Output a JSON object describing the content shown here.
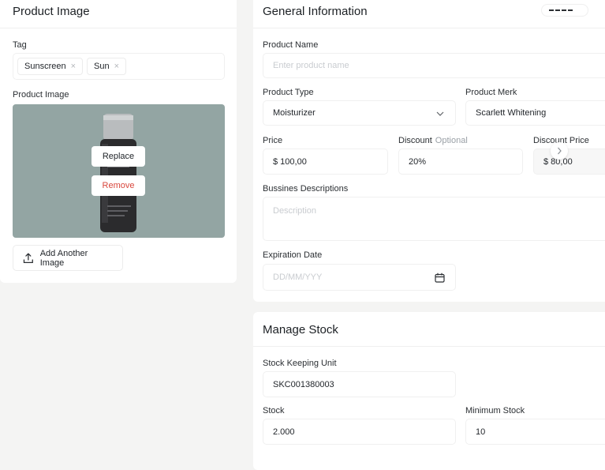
{
  "product_image_card": {
    "title": "Product Image",
    "tag_label": "Tag",
    "tags": [
      "Sunscreen",
      "Sun"
    ],
    "tag_remove_glyph": "×",
    "image_label": "Product Image",
    "replace_label": "Replace",
    "remove_label": "Remove",
    "add_another_label": "Add Another Image"
  },
  "general_info": {
    "title": "General Information",
    "product_name_label": "Product Name",
    "product_name_placeholder": "Enter product name",
    "product_type_label": "Product Type",
    "product_type_value": "Moisturizer",
    "product_merk_label": "Product Merk",
    "product_merk_value": "Scarlett Whitening",
    "price_label": "Price",
    "price_value": "$  100,00",
    "discount_label": "Discount",
    "discount_optional": "Optional",
    "discount_value": "20%",
    "discount_price_label": "Discount Price",
    "discount_price_value": "$  80,00",
    "description_label": "Bussines Descriptions",
    "description_placeholder": "Description",
    "expiration_label": "Expiration Date",
    "expiration_placeholder": "DD/MM/YYY"
  },
  "manage_stock": {
    "title": "Manage Stock",
    "sku_label": "Stock Keeping Unit",
    "sku_value": "SKC001380003",
    "stock_label": "Stock",
    "stock_value": "2.000",
    "min_stock_label": "Minimum Stock",
    "min_stock_value": "10"
  },
  "colors": {
    "page_bg": "#f4f4f3",
    "card_bg": "#ffffff",
    "image_bg": "#93a5a3",
    "remove_red": "#d9473d"
  }
}
